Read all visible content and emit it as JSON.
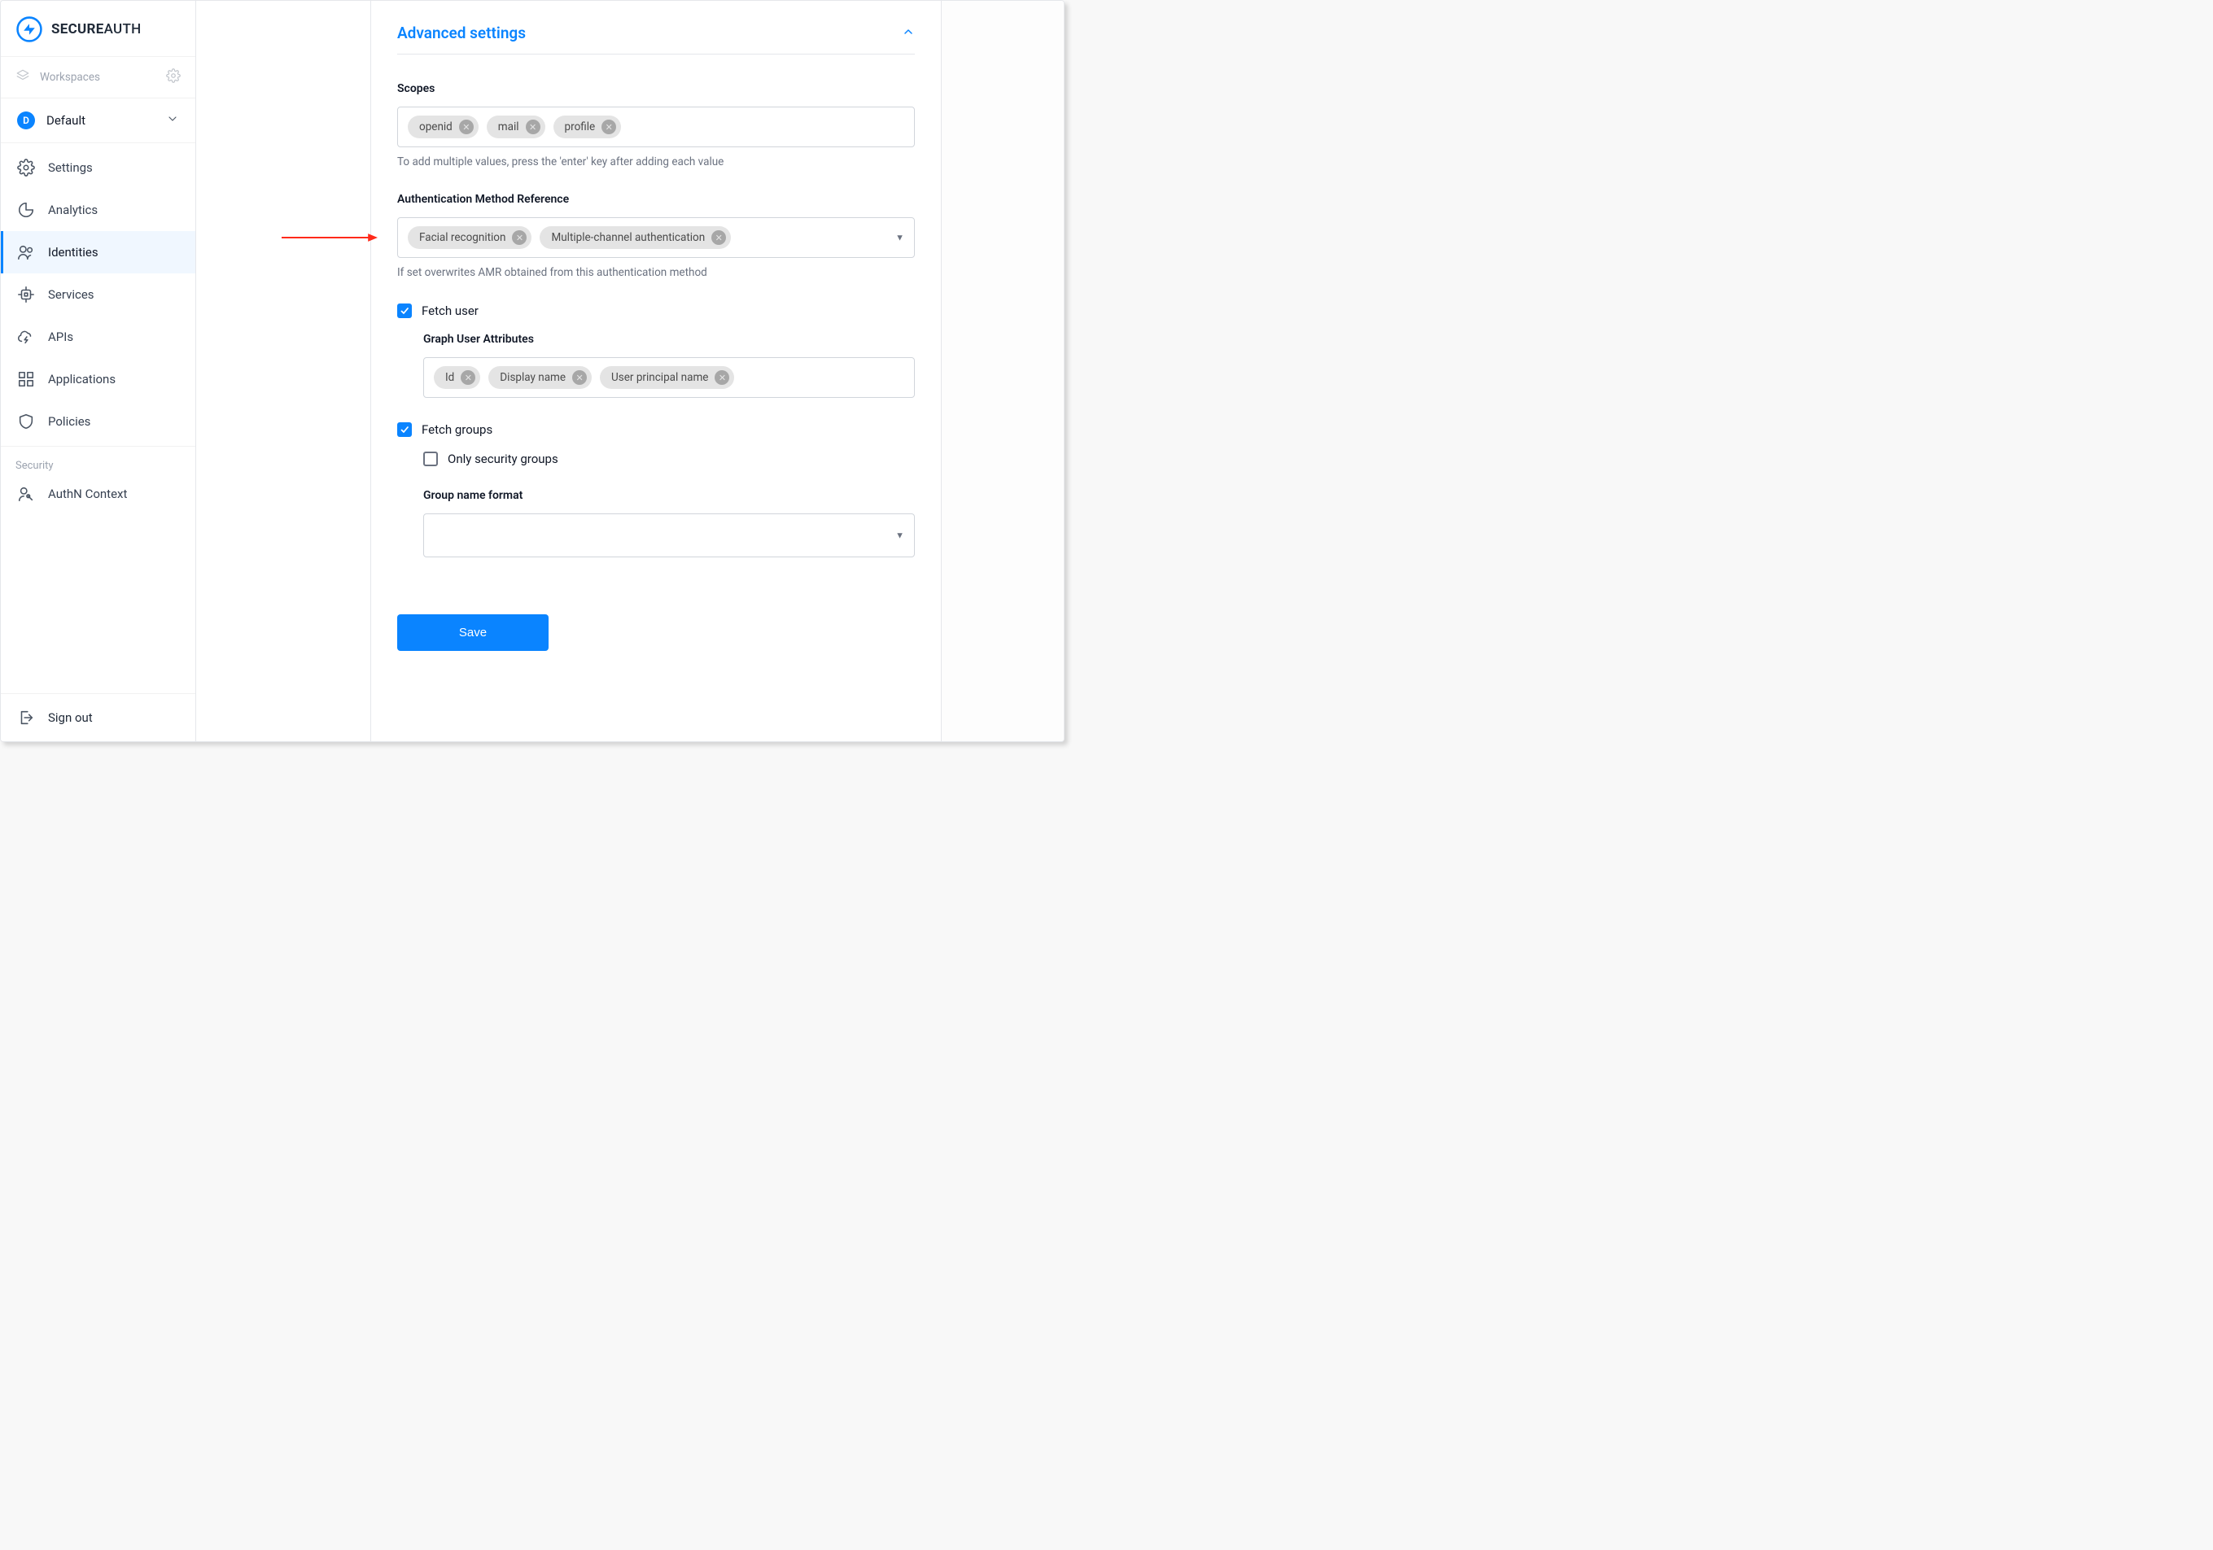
{
  "brand": {
    "bold": "SECURE",
    "thin": "AUTH"
  },
  "sidebar": {
    "workspaces_label": "Workspaces",
    "workspace_badge": "D",
    "workspace_name": "Default",
    "nav": [
      {
        "id": "settings",
        "label": "Settings"
      },
      {
        "id": "analytics",
        "label": "Analytics"
      },
      {
        "id": "identities",
        "label": "Identities"
      },
      {
        "id": "services",
        "label": "Services"
      },
      {
        "id": "apis",
        "label": "APIs"
      },
      {
        "id": "applications",
        "label": "Applications"
      },
      {
        "id": "policies",
        "label": "Policies"
      }
    ],
    "security_label": "Security",
    "authn_context": "AuthN Context",
    "signout": "Sign out"
  },
  "panel": {
    "title": "Advanced settings",
    "scopes": {
      "label": "Scopes",
      "chips": [
        "openid",
        "mail",
        "profile"
      ],
      "helper": "To add multiple values, press the 'enter' key after adding each value"
    },
    "amr": {
      "label": "Authentication Method Reference",
      "chips": [
        "Facial recognition",
        "Multiple-channel authentication"
      ],
      "helper": "If set overwrites AMR obtained from this authentication method"
    },
    "fetch_user": {
      "label": "Fetch user",
      "checked": true,
      "graph_label": "Graph User Attributes",
      "chips": [
        "Id",
        "Display name",
        "User principal name"
      ]
    },
    "fetch_groups": {
      "label": "Fetch groups",
      "checked": true,
      "only_security": {
        "label": "Only security groups",
        "checked": false
      },
      "group_format_label": "Group name format"
    },
    "save_label": "Save"
  }
}
